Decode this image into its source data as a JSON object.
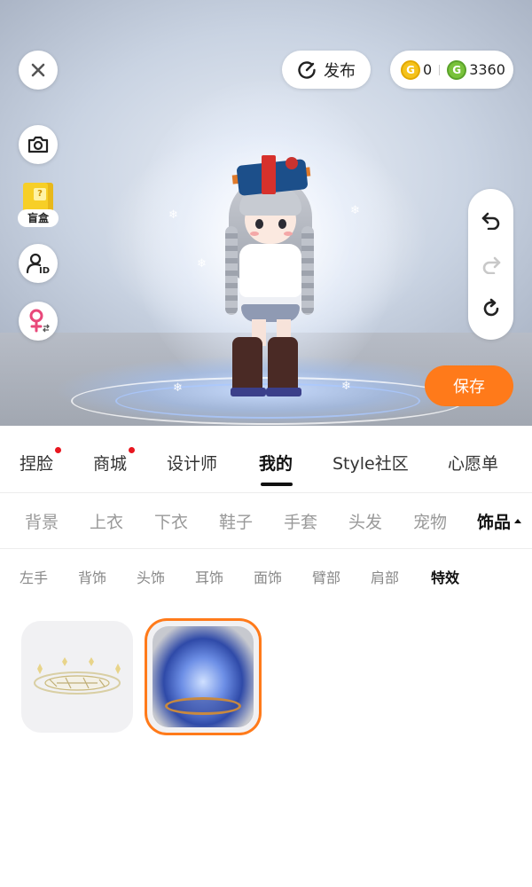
{
  "top_bar": {
    "publish_label": "发布",
    "currency": [
      {
        "icon": "gold-coin-icon",
        "value": "0",
        "color": "#f5c21b"
      },
      {
        "icon": "green-coin-icon",
        "value": "3360",
        "color": "#79c23b"
      }
    ]
  },
  "left_tools": {
    "blind_box_label": "盲盒",
    "blind_box_symbol": "?"
  },
  "save_label": "保存",
  "main_tabs": [
    {
      "label": "捏脸",
      "dot": true
    },
    {
      "label": "商城",
      "dot": true
    },
    {
      "label": "设计师",
      "dot": false
    },
    {
      "label": "我的",
      "dot": false,
      "active": true
    },
    {
      "label": "Style社区",
      "dot": false
    },
    {
      "label": "心愿单",
      "dot": false
    }
  ],
  "sub_tabs": [
    {
      "label": "背景"
    },
    {
      "label": "上衣"
    },
    {
      "label": "下衣"
    },
    {
      "label": "鞋子"
    },
    {
      "label": "手套"
    },
    {
      "label": "头发"
    },
    {
      "label": "宠物"
    },
    {
      "label": "饰品",
      "active": true
    }
  ],
  "category_tabs": [
    {
      "label": "左手"
    },
    {
      "label": "背饰"
    },
    {
      "label": "头饰"
    },
    {
      "label": "耳饰"
    },
    {
      "label": "面饰"
    },
    {
      "label": "臂部"
    },
    {
      "label": "肩部"
    },
    {
      "label": "特效",
      "active": true
    }
  ],
  "items": [
    {
      "name": "white-crystal-halo-effect",
      "selected": false
    },
    {
      "name": "blue-flame-aura-effect",
      "selected": true
    }
  ],
  "colors": {
    "accent": "#ff7a1a",
    "notification_dot": "#e8161f"
  }
}
